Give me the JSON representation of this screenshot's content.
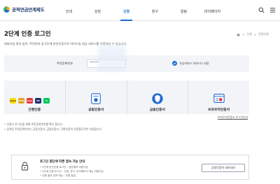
{
  "header": {
    "logo_text": "공적연금연계제도",
    "nav": [
      "안내",
      "상담",
      "신청",
      "장구",
      "알림",
      "마이페이지"
    ],
    "active_index": 2
  },
  "page": {
    "title": "2단계 인증 로그인",
    "breadcrumb": [
      "신청",
      "민원신청"
    ],
    "description": "회원가입 절차 없이, 주민번호 및 2단계 본인인증으로 마이드림 연금 서비스를 이용하실 수 있습니다."
  },
  "id_form": {
    "label": "주민등록번호",
    "value": "******",
    "keyboard_label": "가상키보드 (마우스) 사용"
  },
  "methods": [
    {
      "label": "간편인증",
      "brands": [
        {
          "text": "kakao",
          "color": "#f9e000"
        },
        {
          "text": "PASS",
          "color": "#e2a322"
        },
        {
          "text": "toss",
          "color": "#e4383f"
        },
        {
          "text": "KB",
          "color": "#1e2f6e"
        },
        {
          "text": "N",
          "color": "#03c75a"
        }
      ]
    },
    {
      "label": "공동인증서",
      "icon": "certificate-icon"
    },
    {
      "label": "금융인증서",
      "icon": "shield-icon"
    },
    {
      "label": "브라우저인증서",
      "icon": "browser-certificate-icon"
    }
  ],
  "browser_link": "브라우저인증서 로그인안내",
  "notes": [
    "• 인증서 로그인을 위해 주민등록번호를 확인 합니다.",
    "• 입력된 주민등록번호는 공동인증서, 금융인증서, 간편인증의 인증용도로만 사용됩니다."
  ],
  "notice": {
    "title": "로그인 중단에 따른 접속 가능 안내",
    "items": [
      "• 1단계 본인인증 로그인 : 상담예약 이용가능",
      "• 2단계 인증 로그인 : 신청, 장구, 마이페이지 메뉴 이용가능",
      "• 인증 필요 접속 메뉴 : 민원 발급"
    ],
    "button_label": "공동인증서 내보내기"
  }
}
